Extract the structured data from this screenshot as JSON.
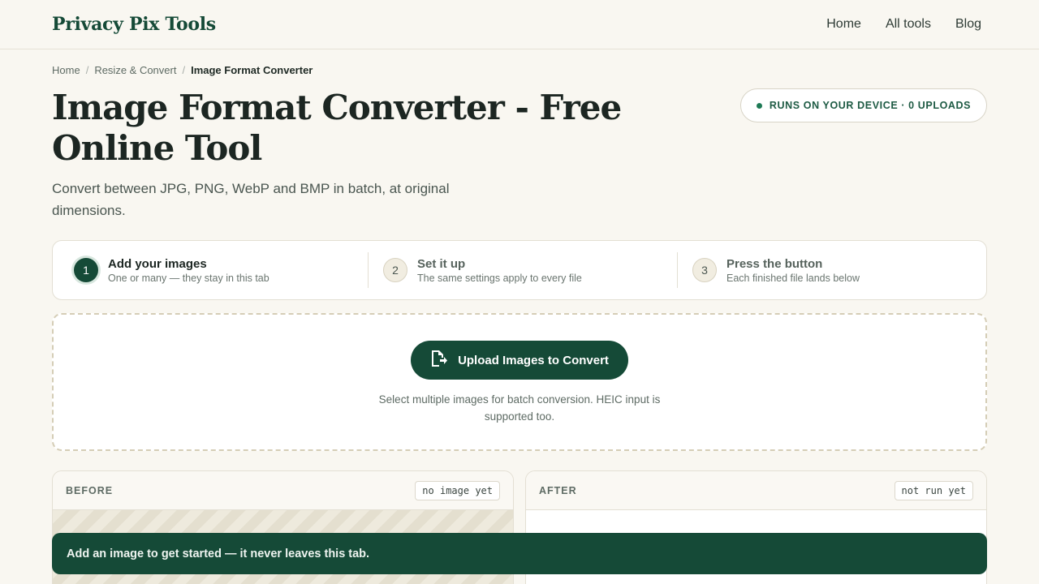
{
  "header": {
    "brand": "Privacy Pix Tools",
    "nav": [
      "Home",
      "All tools",
      "Blog"
    ]
  },
  "breadcrumb": {
    "items": [
      "Home",
      "Resize & Convert"
    ],
    "current": "Image Format Converter",
    "separator": "/"
  },
  "page": {
    "title": "Image Format Converter - Free Online Tool",
    "subtitle": "Convert between JPG, PNG, WebP and BMP in batch, at original dimensions.",
    "badge": "RUNS ON YOUR DEVICE · 0 UPLOADS"
  },
  "steps": [
    {
      "num": "1",
      "title": "Add your images",
      "desc": "One or many — they stay in this tab"
    },
    {
      "num": "2",
      "title": "Set it up",
      "desc": "The same settings apply to every file"
    },
    {
      "num": "3",
      "title": "Press the button",
      "desc": "Each finished file lands below"
    }
  ],
  "upload": {
    "button_label": "Upload Images to Convert",
    "note": "Select multiple images for batch conversion. HEIC input is supported too."
  },
  "before": {
    "label": "BEFORE",
    "status": "no image yet"
  },
  "after": {
    "label": "AFTER",
    "status": "not run yet"
  },
  "toast": "Add an image to get started — it never leaves this tab.",
  "colors": {
    "accent": "#154a37",
    "background": "#f9f7f1"
  }
}
